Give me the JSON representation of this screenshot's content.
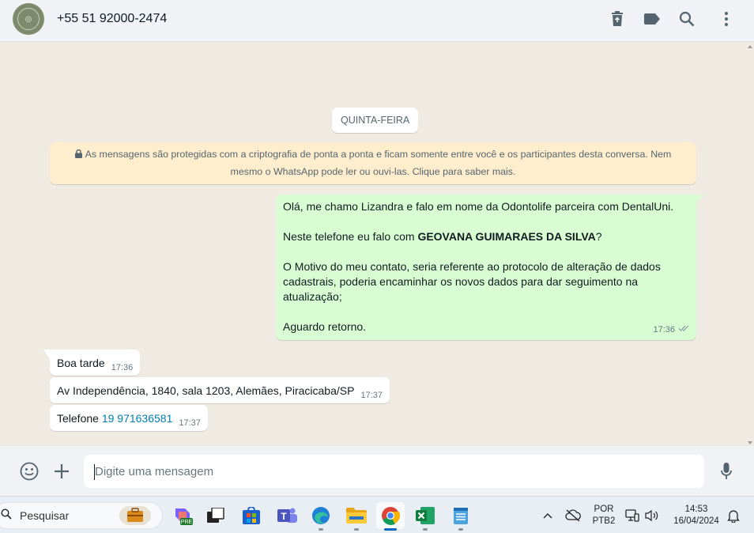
{
  "header": {
    "contact_name": "+55 51 92000-2474",
    "icons": [
      "trash-icon",
      "label-icon",
      "search-icon",
      "menu-icon"
    ]
  },
  "chat": {
    "day_label": "QUINTA-FEIRA",
    "encryption_notice": "As mensagens são protegidas com a criptografia de ponta a ponta e ficam somente entre você e os participantes desta conversa. Nem mesmo o WhatsApp pode ler ou ouvi-las. Clique para saber mais.",
    "outgoing": {
      "line1": "Olá, me chamo Lizandra e falo em nome da Odontolife parceira com DentalUni.",
      "line2_prefix": "Neste telefone eu falo com ",
      "line2_bold": "GEOVANA GUIMARAES DA SILVA",
      "line2_suffix": "?",
      "line3a": "O Motivo do meu contato, seria referente ao protocolo de alteração de dados",
      "line3b": "cadastrais, poderia encaminhar os novos dados para dar seguimento na",
      "line3c": "atualização;",
      "line4": "Aguardo retorno.",
      "time": "17:36"
    },
    "incoming": [
      {
        "text": "Boa tarde",
        "time": "17:36"
      },
      {
        "text": "Av Independência, 1840, sala 1203, Alemães, Piracicaba/SP",
        "time": "17:37"
      },
      {
        "text_prefix": "Telefone ",
        "link": "19 971636581",
        "time": "17:37"
      }
    ]
  },
  "composer": {
    "placeholder": "Digite uma mensagem"
  },
  "taskbar": {
    "search_label": "Pesquisar",
    "language_line1": "POR",
    "language_line2": "PTB2",
    "time": "14:53",
    "date": "16/04/2024",
    "copilot_badge": "PRE"
  },
  "colors": {
    "outgoing_bubble": "#d9fdd3",
    "notice_bg": "#ffeecd",
    "chat_bg": "#efeae2",
    "link": "#027eb5"
  }
}
